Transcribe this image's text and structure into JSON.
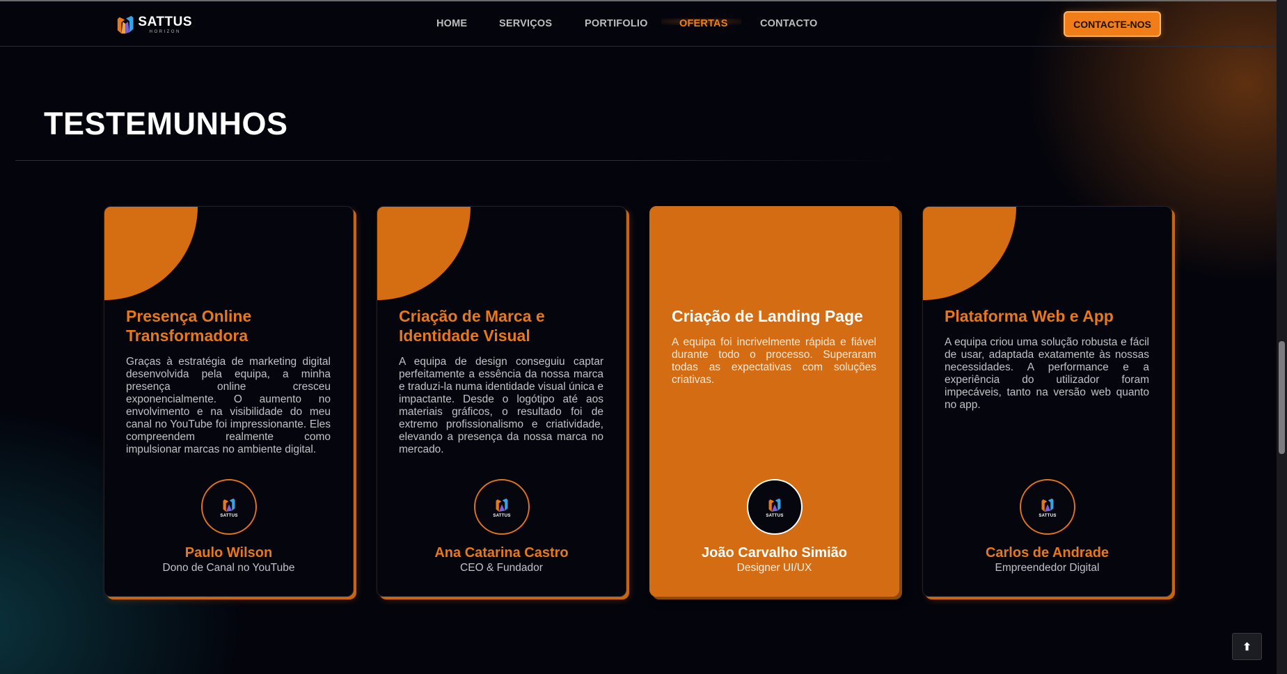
{
  "brand": {
    "name": "SATTUS",
    "subtitle": "HORIZON"
  },
  "nav": {
    "links": [
      {
        "label": "HOME",
        "active": false
      },
      {
        "label": "SERVIÇOS",
        "active": false
      },
      {
        "label": "PORTIFOLIO",
        "active": false
      },
      {
        "label": "OFERTAS",
        "active": true
      },
      {
        "label": "CONTACTO",
        "active": false
      }
    ],
    "cta_label": "CONTACTE-NOS"
  },
  "section": {
    "title": "TESTEMUNHOS"
  },
  "testimonials": [
    {
      "title": "Presença Online Transformadora",
      "text": "Graças à estratégia de marketing digital desenvolvida pela equipa, a minha presença online cresceu exponencialmente. O aumento no envolvimento e na visibilidade do meu canal no YouTube foi impressionante. Eles compreendem realmente como impulsionar marcas no ambiente digital.",
      "avatar_label": "SATTUS",
      "name": "Paulo Wilson",
      "role": "Dono de Canal no YouTube"
    },
    {
      "title": "Criação de Marca e Identidade Visual",
      "text": "A equipa de design conseguiu captar perfeitamente a essência da nossa marca e traduzi-la numa identidade visual única e impactante. Desde o logótipo até aos materiais gráficos, o resultado foi de extremo profissionalismo e criatividade, elevando a presença da nossa marca no mercado.",
      "avatar_label": "SATTUS",
      "name": "Ana Catarina Castro",
      "role": "CEO & Fundador"
    },
    {
      "title": "Criação de Landing Page",
      "text": "A equipa foi incrivelmente rápida e fiável durante todo o processo. Superaram todas as expectativas com soluções criativas.",
      "avatar_label": "SATTUS",
      "name": "João Carvalho Simião",
      "role": "Designer UI/UX"
    },
    {
      "title": "Plataforma Web e App",
      "text": "A equipa criou uma solução robusta e fácil de usar, adaptada exatamente às nossas necessidades. A performance e a experiência do utilizador foram impecáveis, tanto na versão web quanto no app.",
      "avatar_label": "SATTUS",
      "name": "Carlos de Andrade",
      "role": "Empreendedor Digital"
    }
  ],
  "back_to_top": {
    "icon": "arrow-up-icon",
    "glyph": "⬆"
  },
  "colors": {
    "accent": "#e8781a",
    "background": "#03040c",
    "card": "#04050d",
    "highlight_card": "#d36c12"
  }
}
